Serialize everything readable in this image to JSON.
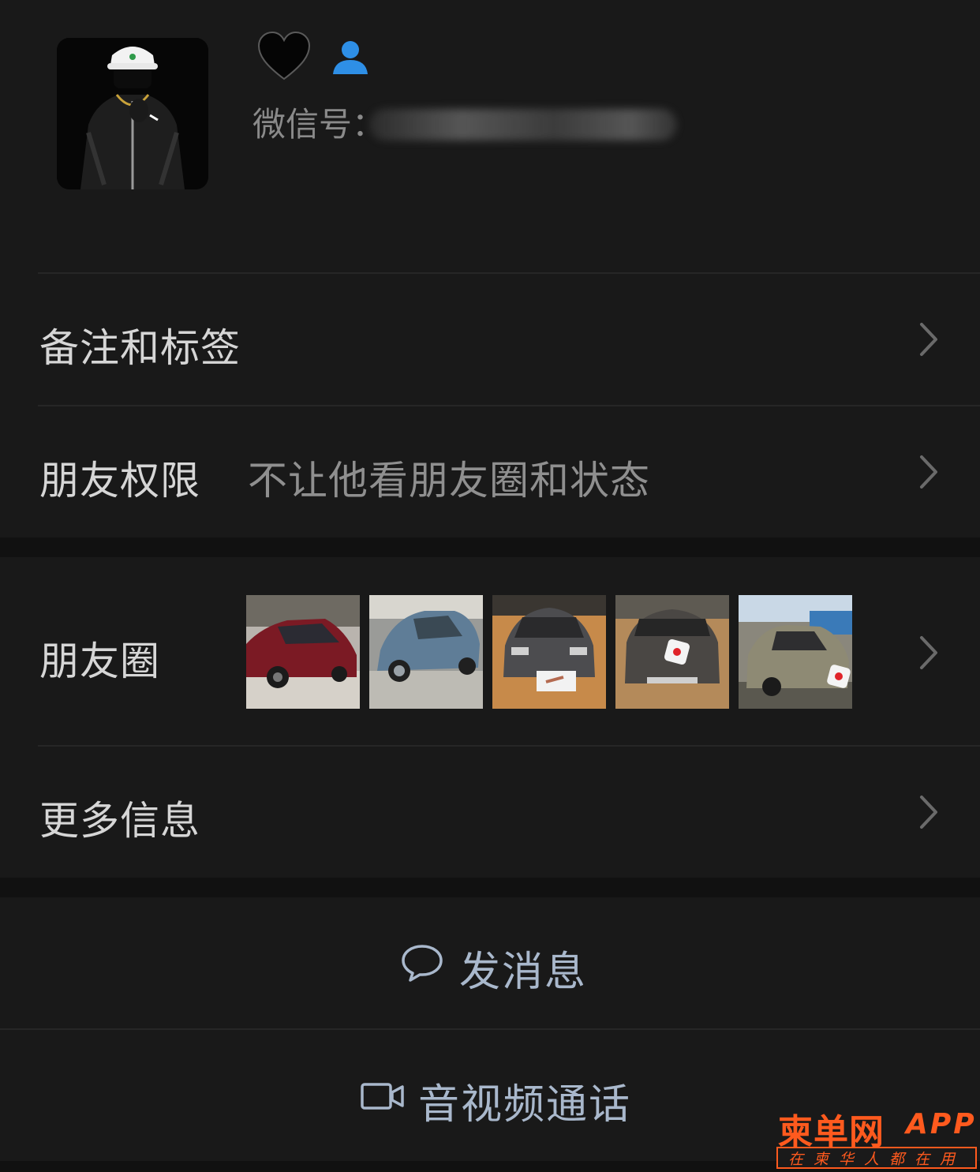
{
  "profile": {
    "nickname_icon": "black-heart-icon",
    "badge_icon": "person-icon",
    "wechat_id_label": "微信号："
  },
  "menu": {
    "remark_label": "备注和标签",
    "permission_label": "朋友权限",
    "permission_value": "不让他看朋友圈和状态",
    "moments_label": "朋友圈",
    "moments_thumbs": [
      "red-car-photo",
      "blue-car-photo",
      "grey-car-front-photo",
      "grey-car-rear-photo",
      "gold-car-photo"
    ],
    "more_label": "更多信息"
  },
  "actions": {
    "message_label": "发消息",
    "call_label": "音视频通话"
  },
  "watermark": {
    "brand": "柬单网",
    "suffix": "APP",
    "slogan": "在柬华人都在用"
  },
  "colors": {
    "background": "#111111",
    "cell": "#191919",
    "action_text": "#a9b8cc",
    "badge_blue": "#2e8fe6",
    "watermark": "#ff5a1e"
  }
}
